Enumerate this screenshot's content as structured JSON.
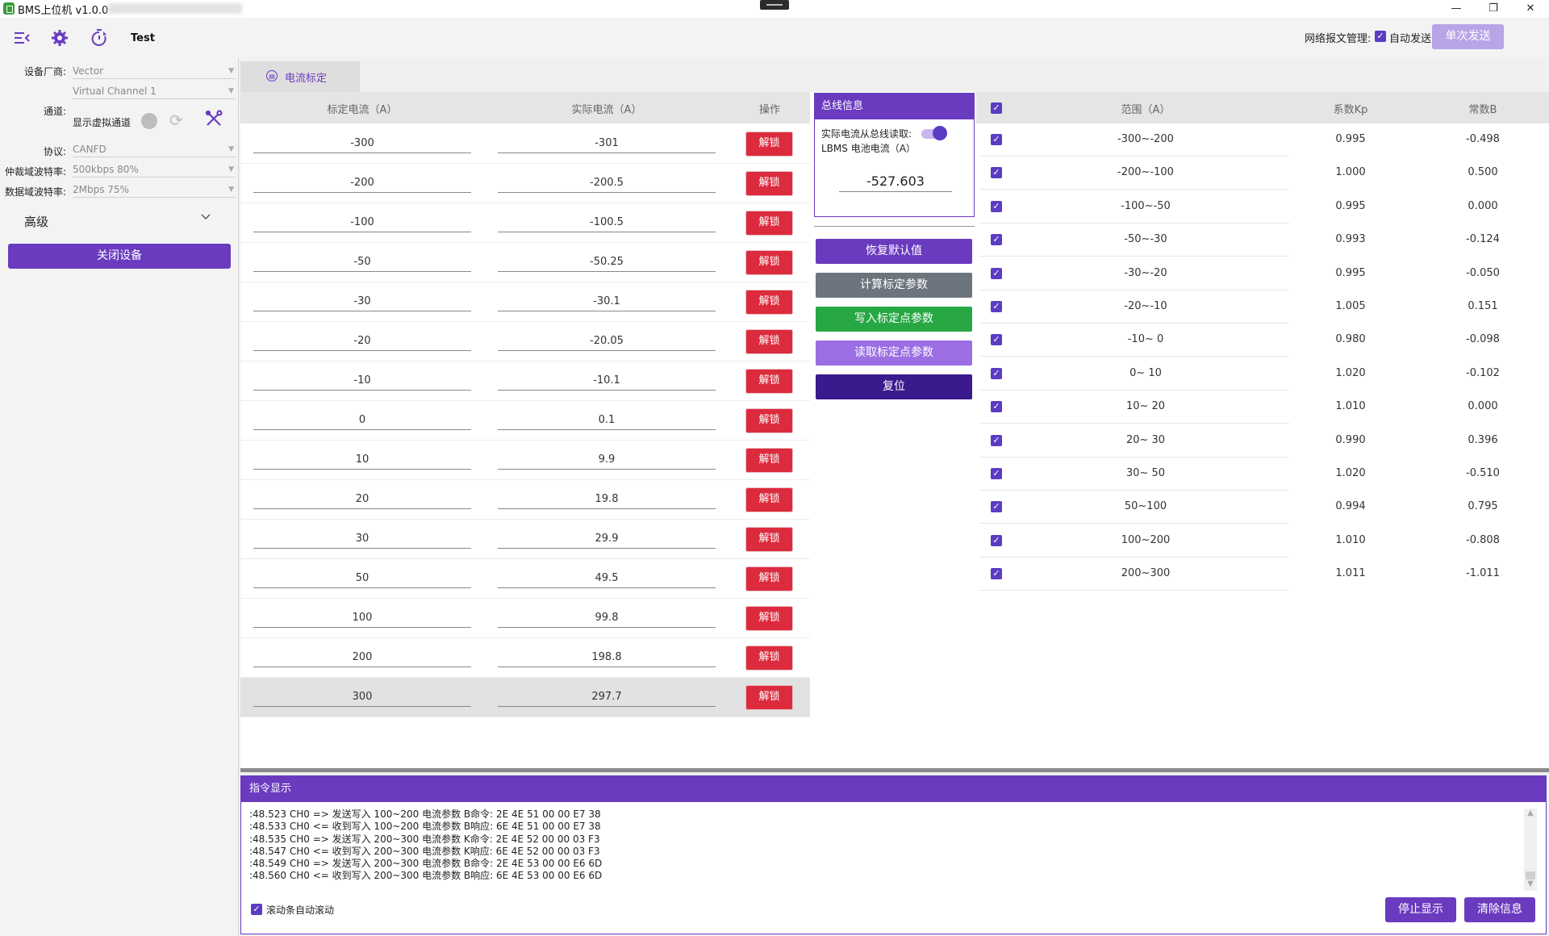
{
  "window": {
    "title": "BMS上位机 v1.0.0 -",
    "minimize": "—",
    "maximize": "❐",
    "close": "✕"
  },
  "toolbar": {
    "menu_icon": "menu-collapse-icon",
    "settings_icon": "gear-icon",
    "timer_icon": "timer-icon",
    "test_label": "Test",
    "net_label": "网络报文管理:",
    "auto_send_label": "自动发送",
    "auto_send_checked": true,
    "single_send_label": "单次发送"
  },
  "device": {
    "vendor_label": "设备厂商:",
    "vendor_value": "Vector",
    "channel_value": "Virtual Channel 1",
    "channel_label": "通道:",
    "show_virtual_label": "显示虚拟通道",
    "protocol_label": "协议:",
    "protocol_value": "CANFD",
    "arb_label": "仲裁域波特率:",
    "arb_value": "500kbps 80%",
    "data_label": "数据域波特率:",
    "data_value": "2Mbps 75%",
    "advanced_label": "高级",
    "close_label": "关闭设备"
  },
  "tab": {
    "label": "电流标定"
  },
  "calib": {
    "col_calib": "标定电流（A）",
    "col_actual": "实际电流（A）",
    "col_op": "操作",
    "unlock_label": "解锁",
    "rows": [
      {
        "calib": "-300",
        "actual": "-301"
      },
      {
        "calib": "-200",
        "actual": "-200.5"
      },
      {
        "calib": "-100",
        "actual": "-100.5"
      },
      {
        "calib": "-50",
        "actual": "-50.25"
      },
      {
        "calib": "-30",
        "actual": "-30.1"
      },
      {
        "calib": "-20",
        "actual": "-20.05"
      },
      {
        "calib": "-10",
        "actual": "-10.1"
      },
      {
        "calib": "0",
        "actual": "0.1"
      },
      {
        "calib": "10",
        "actual": "9.9"
      },
      {
        "calib": "20",
        "actual": "19.8"
      },
      {
        "calib": "30",
        "actual": "29.9"
      },
      {
        "calib": "50",
        "actual": "49.5"
      },
      {
        "calib": "100",
        "actual": "99.8"
      },
      {
        "calib": "200",
        "actual": "198.8"
      },
      {
        "calib": "300",
        "actual": "297.7"
      }
    ]
  },
  "bus": {
    "title": "总线信息",
    "line1": "实际电流从总线读取:",
    "line2": "LBMS 电池电流（A）",
    "toggle_on": true,
    "value": "-527.603"
  },
  "actions": {
    "restore": "恢复默认值",
    "compute": "计算标定参数",
    "write": "写入标定点参数",
    "read": "读取标定点参数",
    "reset": "复位",
    "colors": {
      "restore": "#6a3bbf",
      "compute": "#6c757d",
      "write": "#28a745",
      "read": "#9b6fe3",
      "reset": "#3a1a8c"
    }
  },
  "params": {
    "col_range": "范围（A）",
    "col_kp": "系数Kp",
    "col_b": "常数B",
    "rows": [
      {
        "range": "-300~-200",
        "kp": "0.995",
        "b": "-0.498"
      },
      {
        "range": "-200~-100",
        "kp": "1.000",
        "b": "0.500"
      },
      {
        "range": "-100~-50",
        "kp": "0.995",
        "b": "0.000"
      },
      {
        "range": "-50~-30",
        "kp": "0.993",
        "b": "-0.124"
      },
      {
        "range": "-30~-20",
        "kp": "0.995",
        "b": "-0.050"
      },
      {
        "range": "-20~-10",
        "kp": "1.005",
        "b": "0.151"
      },
      {
        "range": "-10~  0",
        "kp": "0.980",
        "b": "-0.098"
      },
      {
        "range": "0~ 10",
        "kp": "1.020",
        "b": "-0.102"
      },
      {
        "range": "10~ 20",
        "kp": "1.010",
        "b": "0.000"
      },
      {
        "range": "20~ 30",
        "kp": "0.990",
        "b": "0.396"
      },
      {
        "range": "30~ 50",
        "kp": "1.020",
        "b": "-0.510"
      },
      {
        "range": "50~100",
        "kp": "0.994",
        "b": "0.795"
      },
      {
        "range": "100~200",
        "kp": "1.010",
        "b": "-0.808"
      },
      {
        "range": "200~300",
        "kp": "1.011",
        "b": "-1.011"
      }
    ]
  },
  "log": {
    "title": "指令显示",
    "lines": [
      ":48.523 CH0 => 发送写入 100~200 电流参数 B命令: 2E 4E 51 00 00 E7 38",
      ":48.533 CH0 <= 收到写入 100~200 电流参数 B响应: 6E 4E 51 00 00 E7 38",
      ":48.535 CH0 => 发送写入 200~300 电流参数 K命令: 2E 4E 52 00 00 03 F3",
      ":48.547 CH0 <= 收到写入 200~300 电流参数 K响应: 6E 4E 52 00 00 03 F3",
      ":48.549 CH0 => 发送写入 200~300 电流参数 B命令: 2E 4E 53 00 00 E6 6D",
      ":48.560 CH0 <= 收到写入 200~300 电流参数 B响应: 6E 4E 53 00 00 E6 6D"
    ],
    "autoscroll_label": "滚动条自动滚动",
    "stop_label": "停止显示",
    "clear_label": "清除信息"
  }
}
